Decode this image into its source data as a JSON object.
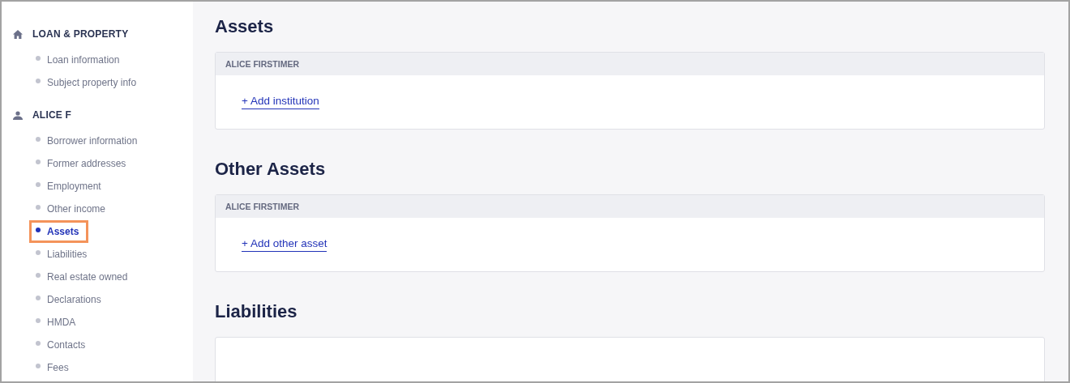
{
  "sidebar": {
    "groups": [
      {
        "kind": "home",
        "label": "LOAN & PROPERTY",
        "items": [
          {
            "label": "Loan information",
            "selected": false,
            "highlighted": false
          },
          {
            "label": "Subject property info",
            "selected": false,
            "highlighted": false
          }
        ]
      },
      {
        "kind": "person",
        "label": "ALICE F",
        "items": [
          {
            "label": "Borrower information",
            "selected": false,
            "highlighted": false
          },
          {
            "label": "Former addresses",
            "selected": false,
            "highlighted": false
          },
          {
            "label": "Employment",
            "selected": false,
            "highlighted": false
          },
          {
            "label": "Other income",
            "selected": false,
            "highlighted": false
          },
          {
            "label": "Assets",
            "selected": true,
            "highlighted": true
          },
          {
            "label": "Liabilities",
            "selected": false,
            "highlighted": false
          },
          {
            "label": "Real estate owned",
            "selected": false,
            "highlighted": false
          },
          {
            "label": "Declarations",
            "selected": false,
            "highlighted": false
          },
          {
            "label": "HMDA",
            "selected": false,
            "highlighted": false
          },
          {
            "label": "Contacts",
            "selected": false,
            "highlighted": false
          },
          {
            "label": "Fees",
            "selected": false,
            "highlighted": false
          }
        ]
      }
    ]
  },
  "sections": [
    {
      "title": "Assets",
      "card": {
        "header": "ALICE FIRSTIMER",
        "link": "+ Add institution"
      }
    },
    {
      "title": "Other Assets",
      "card": {
        "header": "ALICE FIRSTIMER",
        "link": "+ Add other asset"
      }
    },
    {
      "title": "Liabilities"
    }
  ]
}
